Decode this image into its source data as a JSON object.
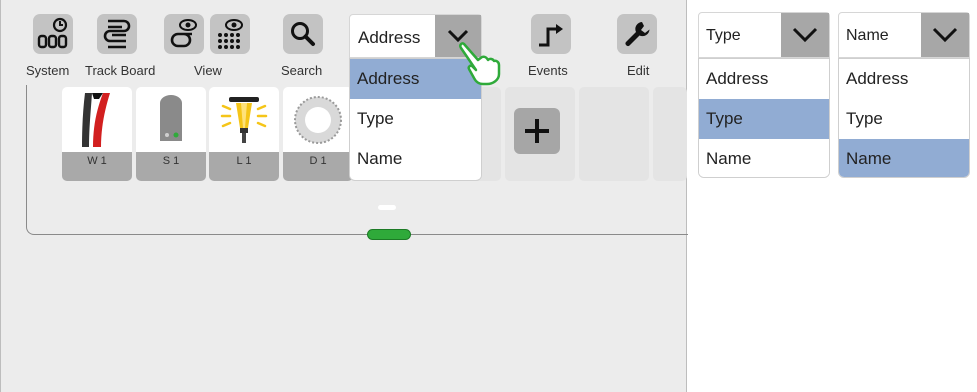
{
  "toolbar": {
    "system_label": "System",
    "trackboard_label": "Track Board",
    "view_label": "View",
    "search_label": "Search",
    "events_label": "Events",
    "edit_label": "Edit"
  },
  "tiles": [
    {
      "label": "W 1",
      "icon": "turnout-icon"
    },
    {
      "label": "S 1",
      "icon": "signal-icon"
    },
    {
      "label": "L 1",
      "icon": "lamp-icon"
    },
    {
      "label": "D 1",
      "icon": "turntable-icon"
    }
  ],
  "dropdowns": [
    {
      "selected": "Address",
      "options": [
        "Address",
        "Type",
        "Name"
      ],
      "highlighted": "Address"
    },
    {
      "selected": "Type",
      "options": [
        "Address",
        "Type",
        "Name"
      ],
      "highlighted": "Type"
    },
    {
      "selected": "Name",
      "options": [
        "Address",
        "Type",
        "Name"
      ],
      "highlighted": "Name"
    }
  ],
  "colors": {
    "highlight": "#91acd3",
    "accent_green": "#2faa3a",
    "button_gray": "#a7a7a7"
  }
}
